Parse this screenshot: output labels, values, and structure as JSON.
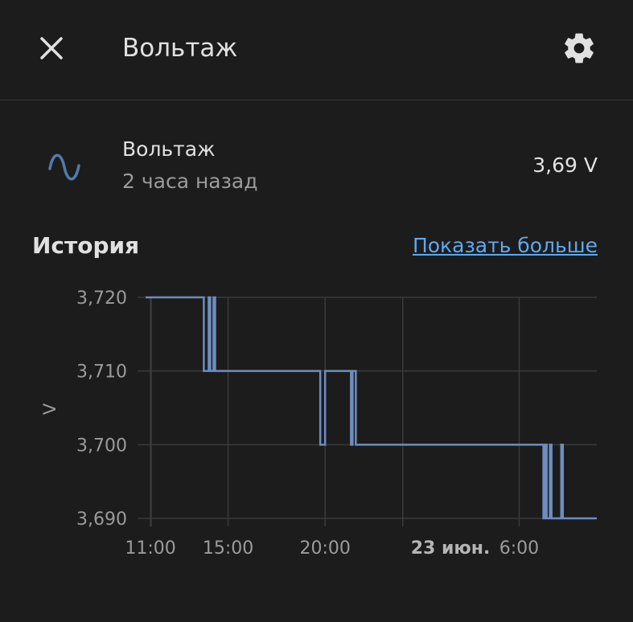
{
  "header": {
    "title": "Вольтаж",
    "close_icon": "close-icon",
    "settings_icon": "gear-icon"
  },
  "entity": {
    "icon": "sine-wave-icon",
    "icon_color": "#4f7bab",
    "name": "Вольтаж",
    "last_changed": "2 часа назад",
    "state": "3,69 V"
  },
  "history": {
    "title": "История",
    "show_more": "Показать больше"
  },
  "colors": {
    "background": "#1c1c1c",
    "line": "#6e8dbf",
    "link": "#5ea9f0",
    "grid": "#3a3a3a"
  },
  "chart_data": {
    "type": "line",
    "step": true,
    "ylabel": "V",
    "ylim": [
      3.69,
      3.72
    ],
    "yticks": [
      3.72,
      3.71,
      3.7,
      3.69
    ],
    "ytick_labels": [
      "3,720",
      "3,710",
      "3,700",
      "3,690"
    ],
    "xlim": [
      "2024-06-22T10:45",
      "2024-06-23T10:00"
    ],
    "xticks": [
      {
        "t": "2024-06-22T11:00",
        "label": "11:00",
        "bold": false
      },
      {
        "t": "2024-06-22T15:00",
        "label": "15:00",
        "bold": false
      },
      {
        "t": "2024-06-22T20:00",
        "label": "20:00",
        "bold": false
      },
      {
        "t": "2024-06-23T00:00",
        "label": "23 июн.",
        "bold": true
      },
      {
        "t": "2024-06-23T06:00",
        "label": "6:00",
        "bold": false
      }
    ],
    "grid": true,
    "series": [
      {
        "points": [
          {
            "t": "2024-06-22T10:45",
            "v": 3.72
          },
          {
            "t": "2024-06-22T13:45",
            "v": 3.71
          },
          {
            "t": "2024-06-22T14:00",
            "v": 3.72
          },
          {
            "t": "2024-06-22T14:05",
            "v": 3.71
          },
          {
            "t": "2024-06-22T14:15",
            "v": 3.72
          },
          {
            "t": "2024-06-22T14:20",
            "v": 3.71
          },
          {
            "t": "2024-06-22T19:45",
            "v": 3.7
          },
          {
            "t": "2024-06-22T20:00",
            "v": 3.71
          },
          {
            "t": "2024-06-22T21:20",
            "v": 3.7
          },
          {
            "t": "2024-06-22T21:25",
            "v": 3.71
          },
          {
            "t": "2024-06-22T21:35",
            "v": 3.7
          },
          {
            "t": "2024-06-23T07:15",
            "v": 3.69
          },
          {
            "t": "2024-06-23T07:20",
            "v": 3.7
          },
          {
            "t": "2024-06-23T07:25",
            "v": 3.69
          },
          {
            "t": "2024-06-23T07:35",
            "v": 3.7
          },
          {
            "t": "2024-06-23T07:40",
            "v": 3.69
          },
          {
            "t": "2024-06-23T08:10",
            "v": 3.7
          },
          {
            "t": "2024-06-23T08:15",
            "v": 3.69
          },
          {
            "t": "2024-06-23T10:00",
            "v": 3.69
          }
        ]
      }
    ]
  }
}
